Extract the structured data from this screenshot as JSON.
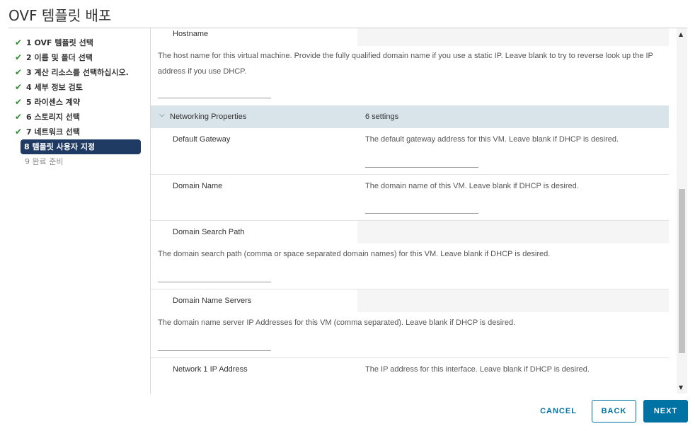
{
  "dialog": {
    "title": "OVF 템플릿 배포"
  },
  "steps": [
    {
      "label": "1 OVF 템플릿 선택",
      "state": "done"
    },
    {
      "label": "2 이름 및 폴더 선택",
      "state": "done"
    },
    {
      "label": "3 계산 리소스를 선택하십시오.",
      "state": "done"
    },
    {
      "label": "4 세부 정보 검토",
      "state": "done"
    },
    {
      "label": "5 라이센스 계약",
      "state": "done"
    },
    {
      "label": "6 스토리지 선택",
      "state": "done"
    },
    {
      "label": "7 네트워크 선택",
      "state": "done"
    },
    {
      "label": "8 템플릿 사용자 지정",
      "state": "active"
    },
    {
      "label": "9 완료 준비",
      "state": "pending"
    }
  ],
  "content": {
    "hostname": {
      "label": "Hostname",
      "description": "The host name for this virtual machine. Provide the fully qualified domain name if you use a static IP. Leave blank to try to reverse look up the IP address if you use DHCP.",
      "value": ""
    },
    "group": {
      "name": "Networking Properties",
      "count": "6 settings"
    },
    "default_gateway": {
      "label": "Default Gateway",
      "description": "The default gateway address for this VM. Leave blank if DHCP is desired.",
      "value": ""
    },
    "domain_name": {
      "label": "Domain Name",
      "description": "The domain name of this VM. Leave blank if DHCP is desired.",
      "value": ""
    },
    "domain_search_path": {
      "label": "Domain Search Path",
      "description": "The domain search path (comma or space separated domain names) for this VM. Leave blank if DHCP is desired.",
      "value": ""
    },
    "domain_name_servers": {
      "label": "Domain Name Servers",
      "description": "The domain name server IP Addresses for this VM (comma separated). Leave blank if DHCP is desired.",
      "value": ""
    },
    "network1_ip": {
      "label": "Network 1 IP Address",
      "description": "The IP address for this interface. Leave blank if DHCP is desired."
    }
  },
  "buttons": {
    "cancel": "CANCEL",
    "back": "BACK",
    "next": "NEXT"
  },
  "icons": {
    "step_done": "checkmark-icon",
    "group_toggle": "chevron-down-icon"
  },
  "colors": {
    "accent": "#0072a3",
    "active_step": "#1f3b63",
    "check": "#2e8b2e",
    "group_header": "#d8e3ea"
  }
}
